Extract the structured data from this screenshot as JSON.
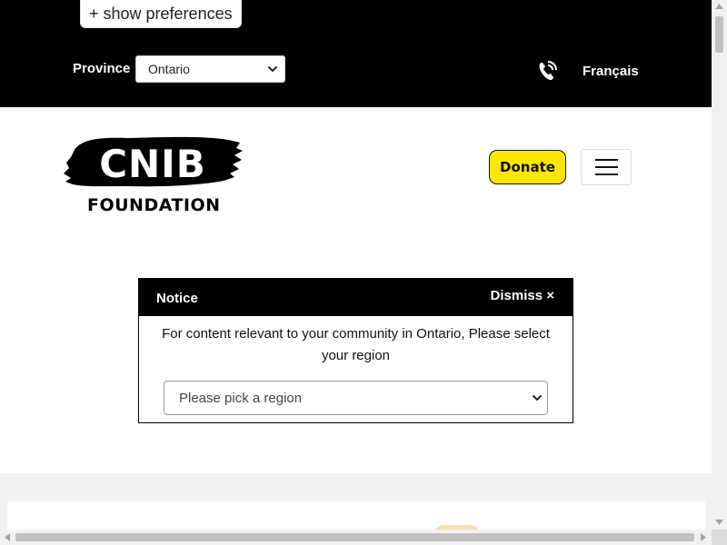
{
  "header": {
    "show_preferences": "+ show preferences",
    "province_label": "Province",
    "province_select": {
      "value": "Ontario"
    },
    "phone_icon": "phone-ringing-icon",
    "language_link": "Français"
  },
  "brand": {
    "logo_text": "CNIB",
    "logo_subtext": "FOUNDATION",
    "accent_color": "#ffe800"
  },
  "nav": {
    "donate_label": "Donate",
    "menu_icon": "hamburger-menu-icon"
  },
  "notice": {
    "title": "Notice",
    "dismiss_label": "Dismiss ×",
    "message": "For content relevant to your community in Ontario, Please select your region",
    "region_select": {
      "value": "Please pick a region"
    }
  }
}
